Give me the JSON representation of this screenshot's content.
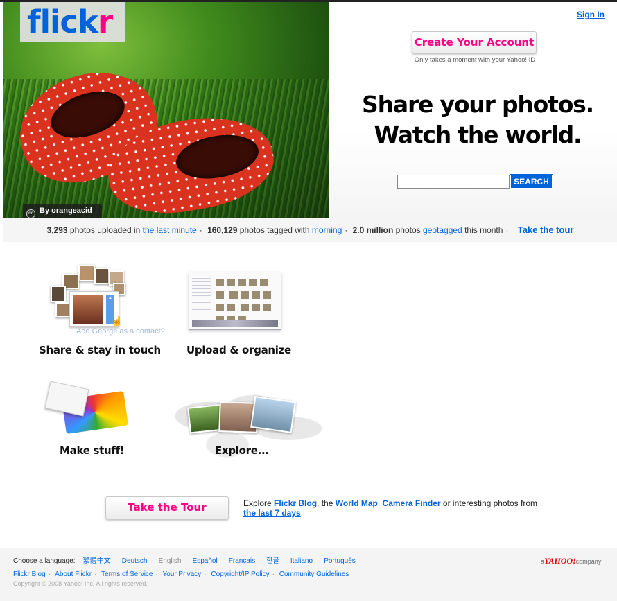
{
  "brand": {
    "logo_left": "flick",
    "logo_right": "r"
  },
  "hero": {
    "photo_credit": "By orangeacid",
    "sign_in": "Sign In",
    "create_account": "Create Your Account",
    "create_sub": "Only takes a moment with your Yahoo! ID",
    "tagline_1": "Share your photos.",
    "tagline_2": "Watch the world.",
    "search_value": "",
    "search_button": "SEARCH"
  },
  "stats": {
    "uploaded_count": "3,293",
    "uploaded_text": "photos uploaded in",
    "uploaded_link": "the last minute",
    "tagged_count": "160,129",
    "tagged_text": "photos tagged with",
    "tagged_link": "morning",
    "geo_count": "2.0 million",
    "geo_text": "photos",
    "geo_link": "geotagged",
    "geo_tail": "this month",
    "tour_link": "Take the tour",
    "separator": "·"
  },
  "features": {
    "share": "Share & stay in touch",
    "share_hint": "Add George as a contact?",
    "upload": "Upload & organize",
    "make": "Make stuff!",
    "explore": "Explore..."
  },
  "tour": {
    "button": "Take the Tour",
    "text_1": "Explore",
    "link_blog": "Flickr Blog",
    "text_2": ", the",
    "link_map": "World Map",
    "text_3": ",",
    "link_camera": "Camera Finder",
    "text_4": "or interesting photos from",
    "link_days": "the last 7 days",
    "text_5": "."
  },
  "footer": {
    "choose_language": "Choose a language:",
    "languages": [
      "繁體中文",
      "Deutsch",
      "English",
      "Español",
      "Français",
      "한글",
      "Italiano",
      "Português"
    ],
    "current_language": "English",
    "links": [
      "Flickr Blog",
      "About Flickr",
      "Terms of Service",
      "Your Privacy",
      "Copyright/IP Policy",
      "Community Guidelines"
    ],
    "copyright": "Copyright © 2008 Yahoo! Inc. All rights reserved.",
    "yahoo_prefix": "a",
    "yahoo_brand": "YAHOO!",
    "yahoo_suffix": "company"
  },
  "colors": {
    "flickr_blue": "#0063dc",
    "flickr_pink": "#ff0084",
    "search_button_bg": "#0063dc"
  }
}
